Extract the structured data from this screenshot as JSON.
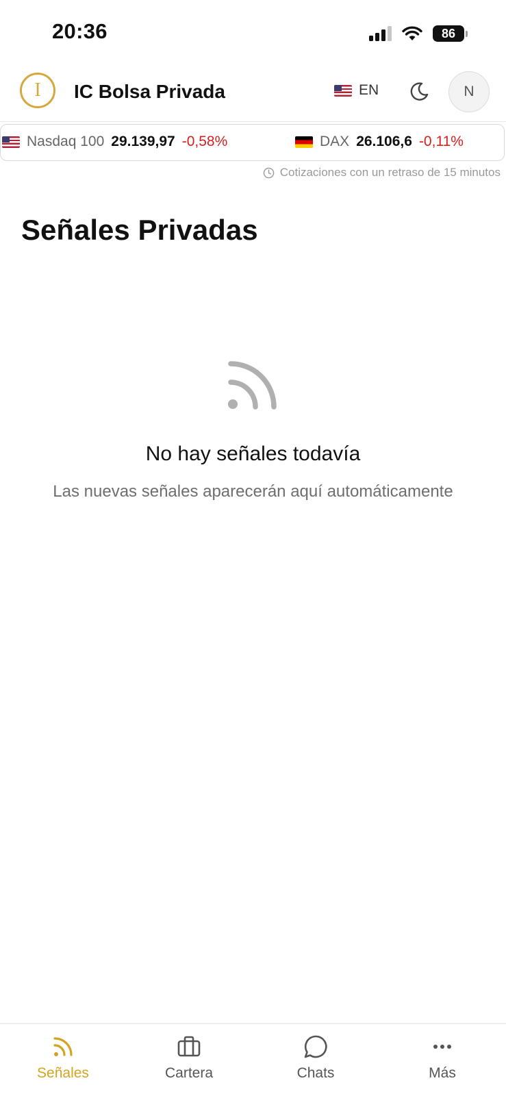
{
  "status_bar": {
    "time": "20:36",
    "battery": "86"
  },
  "header": {
    "app_title": "IC Bolsa Privada",
    "logo_letter": "I",
    "language": "EN",
    "avatar_initial": "N"
  },
  "ticker": [
    {
      "name": "Nasdaq 100",
      "value": "29.139,97",
      "change": "-0,58%",
      "flag": "flag-us-icon"
    },
    {
      "name": "DAX",
      "value": "26.106,6",
      "change": "-0,11%",
      "flag": "flag-de-icon"
    }
  ],
  "delay_note": "Cotizaciones con un retraso de 15 minutos",
  "main": {
    "title": "Señales Privadas",
    "empty_title": "No hay señales todavía",
    "empty_subtitle": "Las nuevas señales aparecerán aquí automáticamente"
  },
  "nav": {
    "senales": "Señales",
    "cartera": "Cartera",
    "chats": "Chats",
    "mas": "Más",
    "active": "senales"
  },
  "colors": {
    "accent": "#d4a31f",
    "negative": "#d61f1f",
    "muted_icon": "#b0b0b0"
  }
}
